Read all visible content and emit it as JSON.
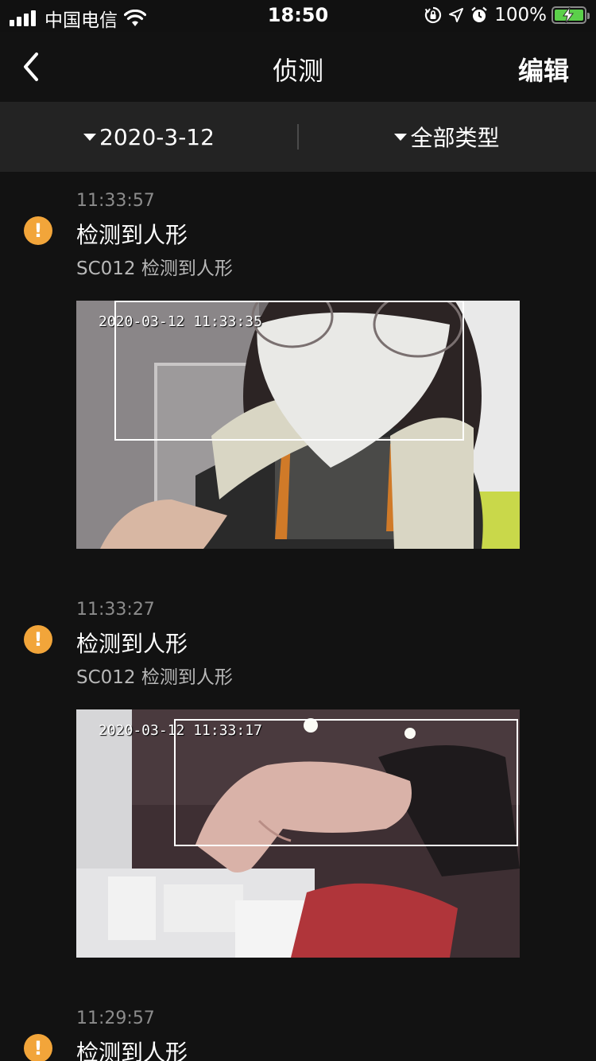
{
  "status_bar": {
    "carrier": "中国电信",
    "time": "18:50",
    "battery_percent": "100%"
  },
  "nav": {
    "title": "侦测",
    "edit_label": "编辑"
  },
  "filters": {
    "date": "2020-3-12",
    "type": "全部类型"
  },
  "events": [
    {
      "time": "11:33:57",
      "icon_glyph": "!",
      "title": "检测到人形",
      "subtitle": "SC012 检测到人形",
      "snapshot_stamp": "2020-03-12  11:33:35"
    },
    {
      "time": "11:33:27",
      "icon_glyph": "!",
      "title": "检测到人形",
      "subtitle": "SC012 检测到人形",
      "snapshot_stamp": "2020-03-12  11:33:17"
    },
    {
      "time": "11:29:57",
      "icon_glyph": "!",
      "title": "检测到人形",
      "subtitle": "",
      "snapshot_stamp": ""
    }
  ],
  "colors": {
    "background": "#121212",
    "filter_bar": "#232323",
    "alert_icon": "#f2a53a",
    "timestamp_text": "#8c8c8c",
    "battery_fill": "#5bd04a"
  },
  "icons": [
    "signal-icon",
    "wifi-icon",
    "orientation-lock-icon",
    "location-icon",
    "alarm-icon",
    "battery-icon",
    "back-chevron-icon",
    "caret-down-icon",
    "alert-icon"
  ]
}
